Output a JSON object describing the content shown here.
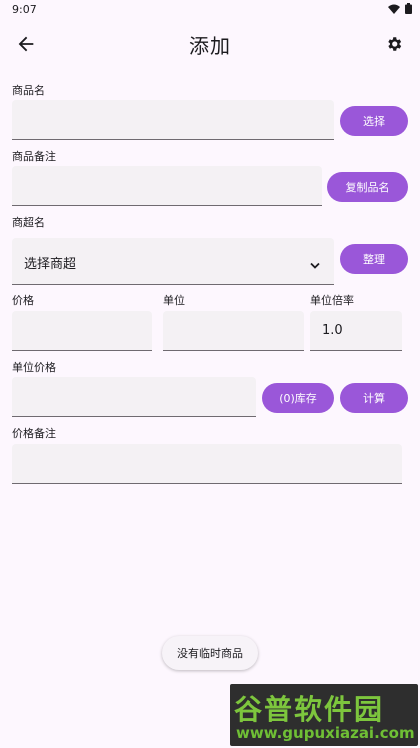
{
  "status": {
    "time": "9:07"
  },
  "header": {
    "title": "添加"
  },
  "form": {
    "product_name": {
      "label": "商品名",
      "value": "",
      "button": "选择"
    },
    "product_note": {
      "label": "商品备注",
      "value": "",
      "button": "复制品名"
    },
    "supermarket": {
      "label": "商超名",
      "selected": "选择商超",
      "button": "整理"
    },
    "price": {
      "label": "价格",
      "value": ""
    },
    "unit": {
      "label": "单位",
      "value": ""
    },
    "unit_multiplier": {
      "label": "单位倍率",
      "value": "1.0"
    },
    "unit_price": {
      "label": "单位价格",
      "value": "",
      "stock_button": "(0)库存",
      "calc_button": "计算"
    },
    "price_note": {
      "label": "价格备注",
      "value": ""
    }
  },
  "bottom": {
    "chip": "没有临时商品"
  },
  "watermark": {
    "brand": "谷普软件园",
    "url": "www.gupuxiazai.com"
  },
  "colors": {
    "accent": "#9a57d9",
    "background": "#fdf7fe",
    "field": "#f4f1f4"
  }
}
